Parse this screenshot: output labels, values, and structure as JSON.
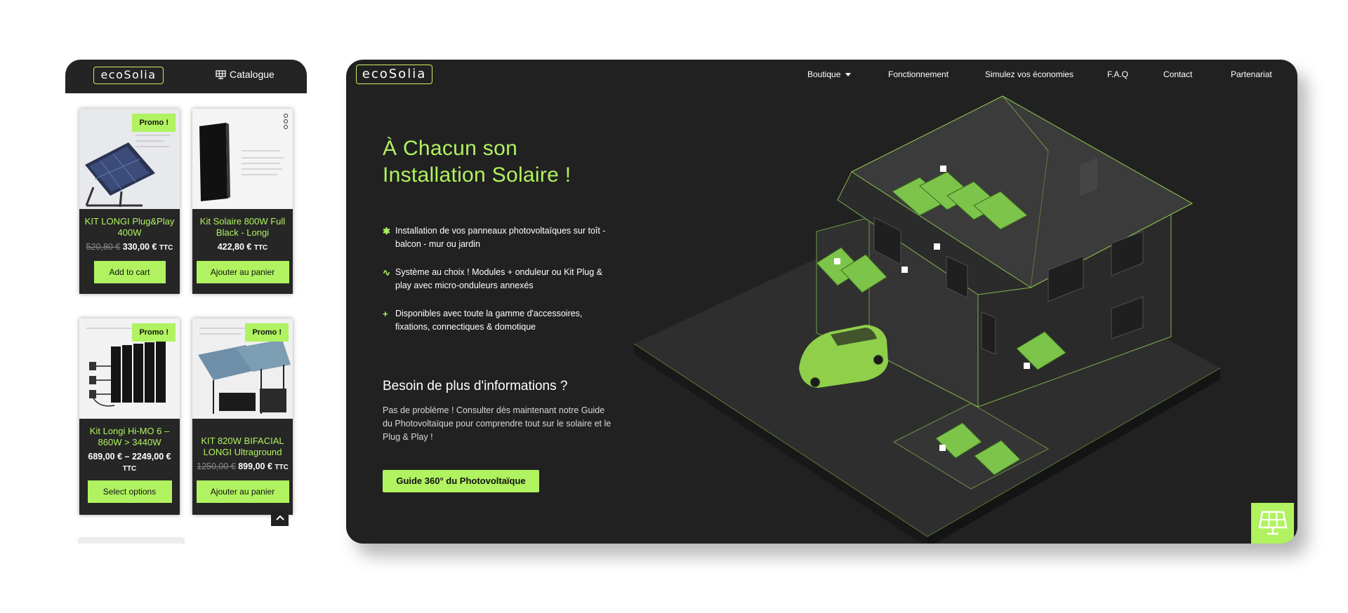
{
  "mobile": {
    "logo": "ecoSolia",
    "catalog_label": "Catalogue",
    "products": [
      {
        "title": "KIT LONGI Plug&Play 400W",
        "old_price": "520,80 €",
        "price": "330,00 €",
        "ttc": "TTC",
        "promo": "Promo !",
        "button": "Add to cart"
      },
      {
        "title": "Kit Solaire 800W Full Black - Longi",
        "old_price": "",
        "price": "422,80 €",
        "ttc": "TTC",
        "promo": "",
        "button": "Ajouter au panier"
      },
      {
        "title": "Kit Longi Hi-MO 6 – 860W > 3440W",
        "old_price": "",
        "price": "689,00 € – 2249,00 €",
        "ttc": "TTC",
        "promo": "Promo !",
        "button": "Select options"
      },
      {
        "title": "KIT 820W BIFACIAL LONGI Ultraground",
        "old_price": "1250,00 €",
        "price": "899,00 €",
        "ttc": "TTC",
        "promo": "Promo !",
        "button": "Ajouter au panier"
      }
    ]
  },
  "desktop": {
    "logo": "ecoSolia",
    "nav": [
      "Boutique",
      "Fonctionnement",
      "Simulez vos économies",
      "F.A.Q",
      "Contact",
      "Partenariat"
    ],
    "hero_title_line1": "À Chacun son",
    "hero_title_line2": "Installation Solaire !",
    "features": [
      {
        "icon": "sparkle-icon",
        "line1": "Installation de vos panneaux photovoltaïques sur toît -",
        "line2": "balcon - mur ou jardin"
      },
      {
        "icon": "pulse-icon",
        "line1": "Système au choix ! Modules + onduleur ou Kit Plug &",
        "line2": "play avec micro-onduleurs annexés"
      },
      {
        "icon": "plus-icon",
        "line1": "Disponibles avec toute la gamme d'accessoires,",
        "line2": "fixations, connectiques & domotique"
      }
    ],
    "info_title": "Besoin de plus d'informations ?",
    "info_line1": "Pas de problème ! Consulter dès maintenant notre Guide",
    "info_line2": "du Photovoltaïque pour comprendre tout sur le solaire et le",
    "info_line3": "Plug & Play !",
    "guide_button": "Guide 360° du Photovoltaïque"
  },
  "colors": {
    "accent": "#b0f25f",
    "dark": "#212121",
    "card_bg": "#262626"
  }
}
